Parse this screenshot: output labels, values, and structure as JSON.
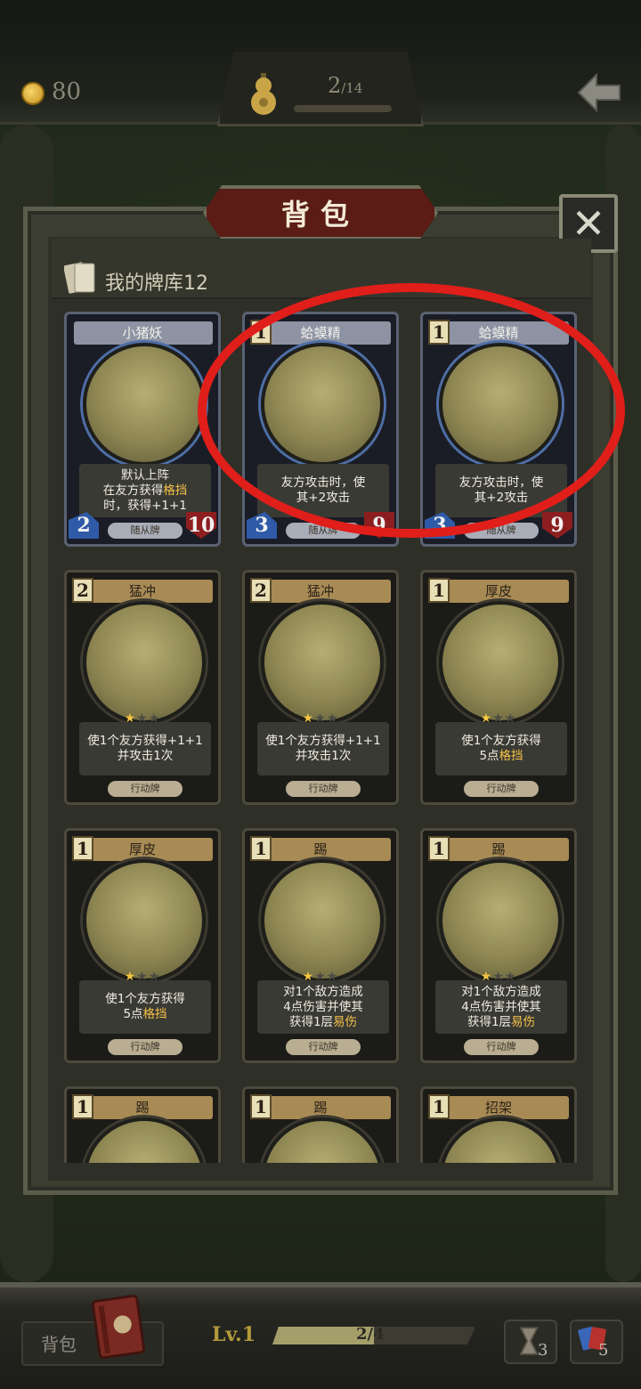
{
  "topbar": {
    "coins": "80",
    "stage_current": "2",
    "stage_total": "/14"
  },
  "panel": {
    "title": "背包",
    "close_label": "✕",
    "deck_label": "我的牌库12"
  },
  "cards": [
    {
      "name": "小猪妖",
      "cost": "",
      "kind": "minion",
      "desc": [
        "默认上阵",
        "在友方获得|格挡",
        "时，获得+1+1"
      ],
      "type": "随从牌",
      "atk": "2",
      "hp": "10",
      "stars": 0
    },
    {
      "name": "蛤蟆精",
      "cost": "1",
      "kind": "minion",
      "desc": [
        "友方攻击时，使",
        "其+2攻击"
      ],
      "type": "随从牌",
      "atk": "3",
      "hp": "9",
      "stars": 0
    },
    {
      "name": "蛤蟆精",
      "cost": "1",
      "kind": "minion",
      "desc": [
        "友方攻击时，使",
        "其+2攻击"
      ],
      "type": "随从牌",
      "atk": "3",
      "hp": "9",
      "stars": 0
    },
    {
      "name": "猛冲",
      "cost": "2",
      "kind": "action",
      "desc": [
        "使1个友方获得+1+1",
        "并攻击1次"
      ],
      "type": "行动牌",
      "stars": 1
    },
    {
      "name": "猛冲",
      "cost": "2",
      "kind": "action",
      "desc": [
        "使1个友方获得+1+1",
        "并攻击1次"
      ],
      "type": "行动牌",
      "stars": 1
    },
    {
      "name": "厚皮",
      "cost": "1",
      "kind": "action",
      "desc": [
        "使1个友方获得",
        "5点|格挡"
      ],
      "type": "行动牌",
      "stars": 1
    },
    {
      "name": "厚皮",
      "cost": "1",
      "kind": "action",
      "desc": [
        "使1个友方获得",
        "5点|格挡"
      ],
      "type": "行动牌",
      "stars": 1
    },
    {
      "name": "踢",
      "cost": "1",
      "kind": "action",
      "desc": [
        "对1个敌方造成",
        "4点伤害并使其",
        "获得1层|易伤"
      ],
      "type": "行动牌",
      "stars": 1
    },
    {
      "name": "踢",
      "cost": "1",
      "kind": "action",
      "desc": [
        "对1个敌方造成",
        "4点伤害并使其",
        "获得1层|易伤"
      ],
      "type": "行动牌",
      "stars": 1
    },
    {
      "name": "踢",
      "cost": "1",
      "kind": "action",
      "desc": [],
      "type": "",
      "stars": 0
    },
    {
      "name": "踢",
      "cost": "1",
      "kind": "action",
      "desc": [],
      "type": "",
      "stars": 0
    },
    {
      "name": "招架",
      "cost": "1",
      "kind": "action",
      "desc": [],
      "type": "",
      "stars": 0
    }
  ],
  "bottombar": {
    "bag_label": "背包",
    "level": "Lv.1",
    "xp_text": "2/4",
    "xp_progress": 0.5,
    "hourglass_count": "3",
    "deck_count": "5"
  },
  "colors": {
    "highlight": "#e01e1a",
    "keyword": "#f5c24a",
    "title_banner": "#5a1c15"
  },
  "icons": [
    "coin-icon",
    "gourd-icon",
    "back-arrow-icon",
    "close-icon",
    "deck-cards-icon",
    "book-icon",
    "hourglass-icon",
    "cards-icon"
  ]
}
